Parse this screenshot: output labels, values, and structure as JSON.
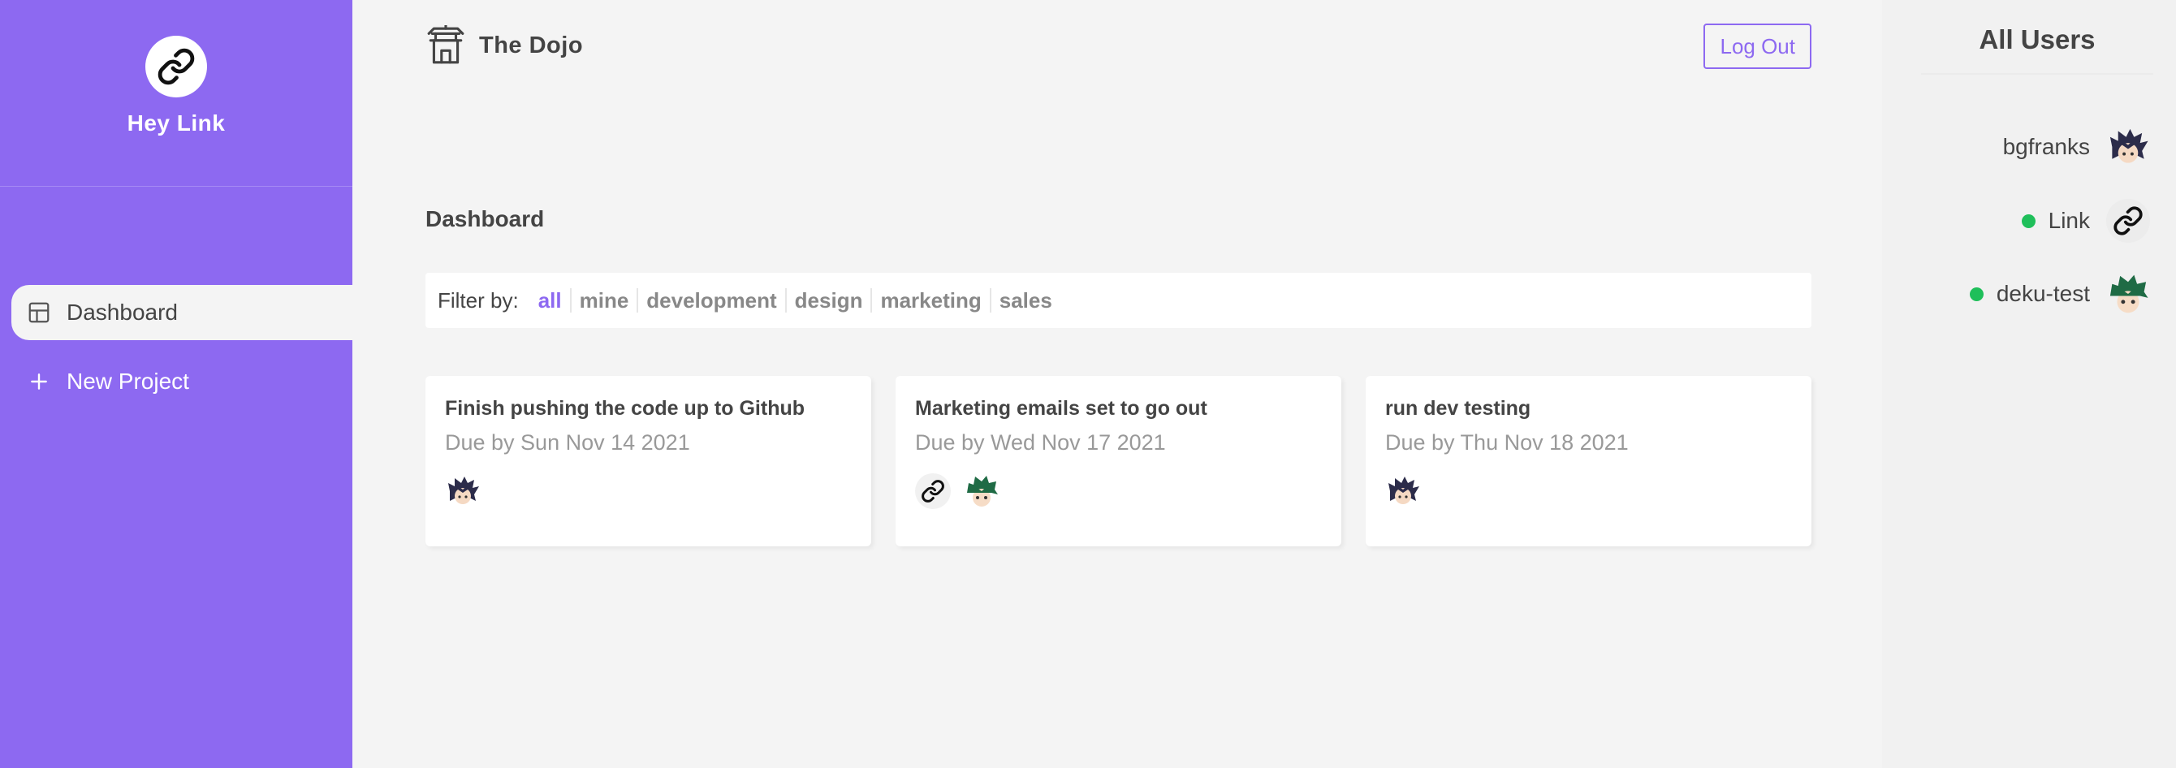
{
  "sidebar": {
    "user_name": "Hey Link",
    "avatar_icon": "link-icon",
    "nav": [
      {
        "label": "Dashboard",
        "icon": "dashboard-icon",
        "active": true
      },
      {
        "label": "New Project",
        "icon": "plus-icon",
        "active": false
      }
    ]
  },
  "navbar": {
    "brand": "The Dojo",
    "brand_icon": "temple-icon",
    "logout_label": "Log Out"
  },
  "dashboard": {
    "title": "Dashboard",
    "filter": {
      "label": "Filter by:",
      "options": [
        "all",
        "mine",
        "development",
        "design",
        "marketing",
        "sales"
      ],
      "selected": "all"
    },
    "projects": [
      {
        "title": "Finish pushing the code up to Github",
        "due": "Due by Sun Nov 14 2021",
        "assignees": [
          "ninja-avatar"
        ]
      },
      {
        "title": "Marketing emails set to go out",
        "due": "Due by Wed Nov 17 2021",
        "assignees": [
          "link-avatar",
          "green-hair-avatar"
        ]
      },
      {
        "title": "run dev testing",
        "due": "Due by Thu Nov 18 2021",
        "assignees": [
          "ninja-avatar"
        ]
      }
    ]
  },
  "users": {
    "title": "All Users",
    "list": [
      {
        "name": "bgfranks",
        "online": false,
        "avatar": "ninja-avatar"
      },
      {
        "name": "Link",
        "online": true,
        "avatar": "link-avatar"
      },
      {
        "name": "deku-test",
        "online": true,
        "avatar": "green-hair-avatar"
      }
    ]
  },
  "colors": {
    "primary": "#8d69f1",
    "background": "#f4f4f4",
    "online": "#1fbf5a"
  }
}
